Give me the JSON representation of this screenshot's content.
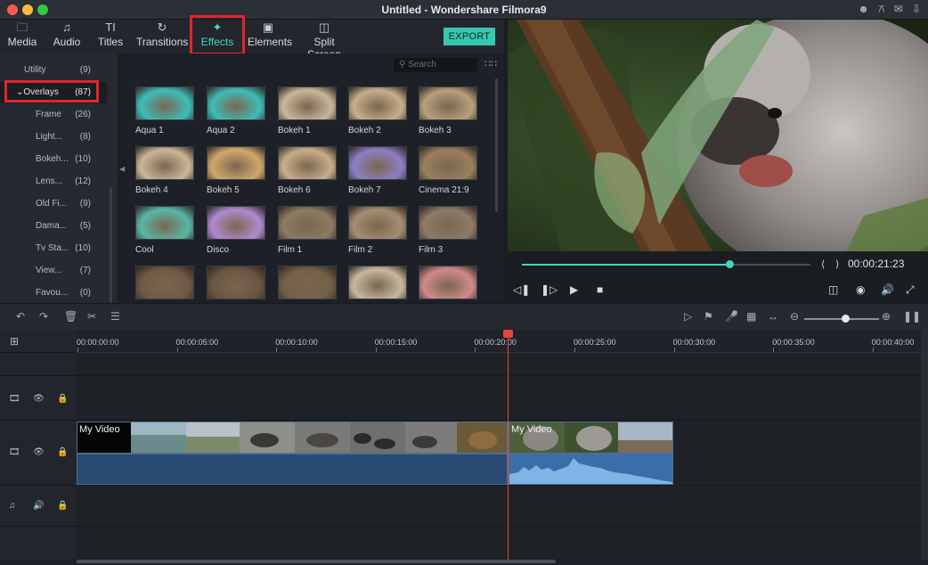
{
  "window": {
    "title": "Untitled - Wondershare Filmora9"
  },
  "titlebar_icons": [
    "user-icon",
    "cart-icon",
    "cart-icon",
    "mail-icon",
    "download-icon"
  ],
  "toolbar": {
    "tabs": [
      {
        "label": "Media",
        "icon": "folder-icon"
      },
      {
        "label": "Audio",
        "icon": "music-note-icon"
      },
      {
        "label": "Titles",
        "icon": "text-icon"
      },
      {
        "label": "Transitions",
        "icon": "transition-icon"
      },
      {
        "label": "Effects",
        "icon": "effects-icon",
        "active": true
      },
      {
        "label": "Elements",
        "icon": "image-icon"
      },
      {
        "label": "Split Screen",
        "icon": "split-screen-icon"
      }
    ],
    "export_label": "EXPORT"
  },
  "categories": [
    {
      "label": "Utility",
      "count": "(9)"
    },
    {
      "label": "Overlays",
      "count": "(87)",
      "expanded": true
    },
    {
      "label": "Frame",
      "count": "(26)"
    },
    {
      "label": "Light...",
      "count": "(8)"
    },
    {
      "label": "Bokeh...",
      "count": "(10)"
    },
    {
      "label": "Lens...",
      "count": "(12)"
    },
    {
      "label": "Old Fi...",
      "count": "(9)"
    },
    {
      "label": "Dama...",
      "count": "(5)"
    },
    {
      "label": "Tv Sta...",
      "count": "(10)"
    },
    {
      "label": "View...",
      "count": "(7)"
    },
    {
      "label": "Favou...",
      "count": "(0)"
    }
  ],
  "search": {
    "placeholder": "Search"
  },
  "effects": [
    {
      "name": "Aqua 1",
      "tint": "#3fbcb9"
    },
    {
      "name": "Aqua 2",
      "tint": "#3fbcb9"
    },
    {
      "name": "Bokeh 1",
      "tint": "#c9b79a"
    },
    {
      "name": "Bokeh 2",
      "tint": "#c7ae8c"
    },
    {
      "name": "Bokeh 3",
      "tint": "#b9a07b"
    },
    {
      "name": "Bokeh 4",
      "tint": "#cbb797"
    },
    {
      "name": "Bokeh 5",
      "tint": "#d2a86c"
    },
    {
      "name": "Bokeh 6",
      "tint": "#c8ae8a"
    },
    {
      "name": "Bokeh 7",
      "tint": "#8d7fc4"
    },
    {
      "name": "Cinema 21:9",
      "tint": "#9a7f5f"
    },
    {
      "name": "Cool",
      "tint": "#5ab7a6"
    },
    {
      "name": "Disco",
      "tint": "#b08ad0"
    },
    {
      "name": "Film 1",
      "tint": "#8c7a63"
    },
    {
      "name": "Film 2",
      "tint": "#a48e72"
    },
    {
      "name": "Film 3",
      "tint": "#8d7b66"
    },
    {
      "name": "",
      "tint": "#6e5a45"
    },
    {
      "name": "",
      "tint": "#6a5642"
    },
    {
      "name": "",
      "tint": "#736048"
    },
    {
      "name": "",
      "tint": "#c8b8a0"
    },
    {
      "name": "",
      "tint": "#d08a8a"
    }
  ],
  "preview": {
    "timecode": "00:00:21:23",
    "progress": 0.72
  },
  "timeline": {
    "ruler": [
      "00:00:00:00",
      "00:00:05:00",
      "00:00:10:00",
      "00:00:15:00",
      "00:00:20:00",
      "00:00:25:00",
      "00:00:30:00",
      "00:00:35:00",
      "00:00:40:00"
    ],
    "zoom_level": 0.55,
    "clips": [
      {
        "label": "My Video"
      },
      {
        "label": "My Video"
      }
    ]
  },
  "colors": {
    "accent": "#43d6c6",
    "highlight": "#e0252f",
    "playhead": "#e8453c",
    "clip": "#294a72"
  }
}
